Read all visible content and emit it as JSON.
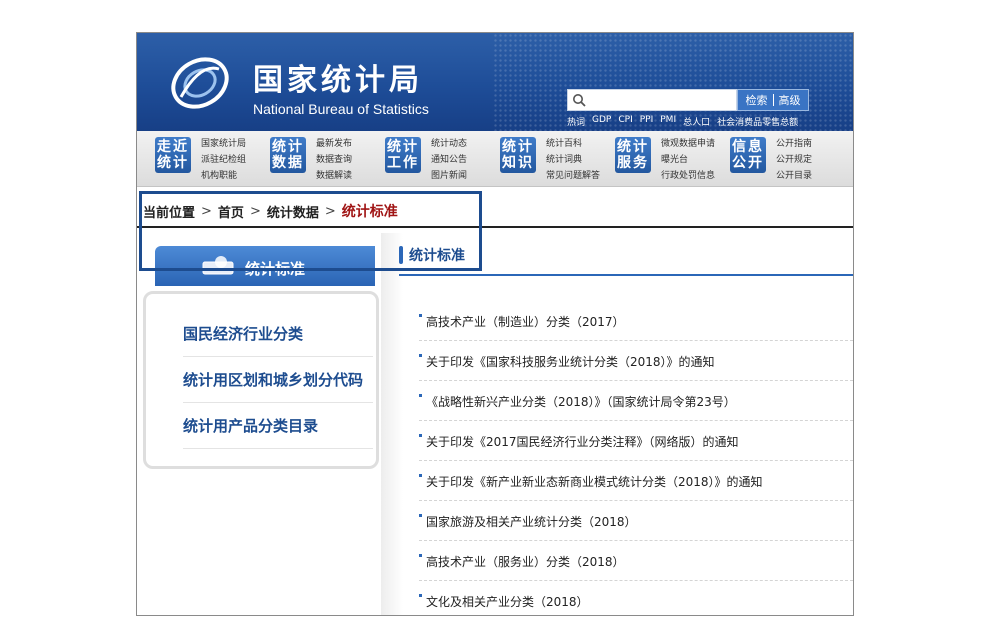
{
  "header": {
    "title": "国家统计局",
    "subtitle": "National Bureau of Statistics",
    "search": {
      "value": "",
      "button_search": "检索",
      "button_advanced": "高级"
    },
    "hotwords": [
      "热词",
      "GDP",
      "CPI",
      "PPI",
      "PMI",
      "总人口",
      "社会消费品零售总额"
    ]
  },
  "nav": [
    {
      "badge": "走近\n统计",
      "links": [
        "国家统计局",
        "派驻纪检组",
        "机构职能"
      ]
    },
    {
      "badge": "统计\n数据",
      "links": [
        "最新发布",
        "数据查询",
        "数据解读"
      ]
    },
    {
      "badge": "统计\n工作",
      "links": [
        "统计动态",
        "通知公告",
        "图片新闻"
      ]
    },
    {
      "badge": "统计\n知识",
      "links": [
        "统计百科",
        "统计词典",
        "常见问题解答"
      ]
    },
    {
      "badge": "统计\n服务",
      "links": [
        "微观数据申请",
        "曝光台",
        "行政处罚信息"
      ]
    },
    {
      "badge": "信息\n公开",
      "links": [
        "公开指南",
        "公开规定",
        "公开目录"
      ]
    }
  ],
  "breadcrumb": {
    "label": "当前位置",
    "items": [
      "首页",
      "统计数据"
    ],
    "current": "统计标准"
  },
  "sidebar": {
    "tab": "统计标准",
    "items": [
      "国民经济行业分类",
      "统计用区划和城乡划分代码",
      "统计用产品分类目录"
    ]
  },
  "content": {
    "title": "统计标准",
    "items": [
      "高技术产业（制造业）分类（2017）",
      "关于印发《国家科技服务业统计分类（2018）》的通知",
      "《战略性新兴产业分类（2018）》（国家统计局令第23号）",
      "关于印发《2017国民经济行业分类注释》（网络版）的通知",
      "关于印发《新产业新业态新商业模式统计分类（2018）》的通知",
      "国家旅游及相关产业统计分类（2018）",
      "高技术产业（服务业）分类（2018）",
      "文化及相关产业分类（2018）"
    ]
  },
  "colors": {
    "brand": "#1d4c8f",
    "accent_red": "#a01515",
    "nav_blue": "#2b67b8"
  }
}
